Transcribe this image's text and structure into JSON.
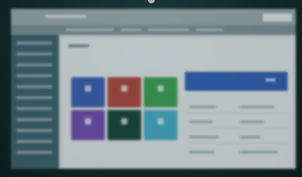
{
  "screen": {
    "colors": {
      "tile_colors": [
        "#3a5fc6",
        "#c2443a",
        "#33a84a",
        "#7a4cc6",
        "#164a3a",
        "#3bb5d6"
      ],
      "accent": "#2d63c8",
      "sidebar": "#3b6672"
    }
  }
}
